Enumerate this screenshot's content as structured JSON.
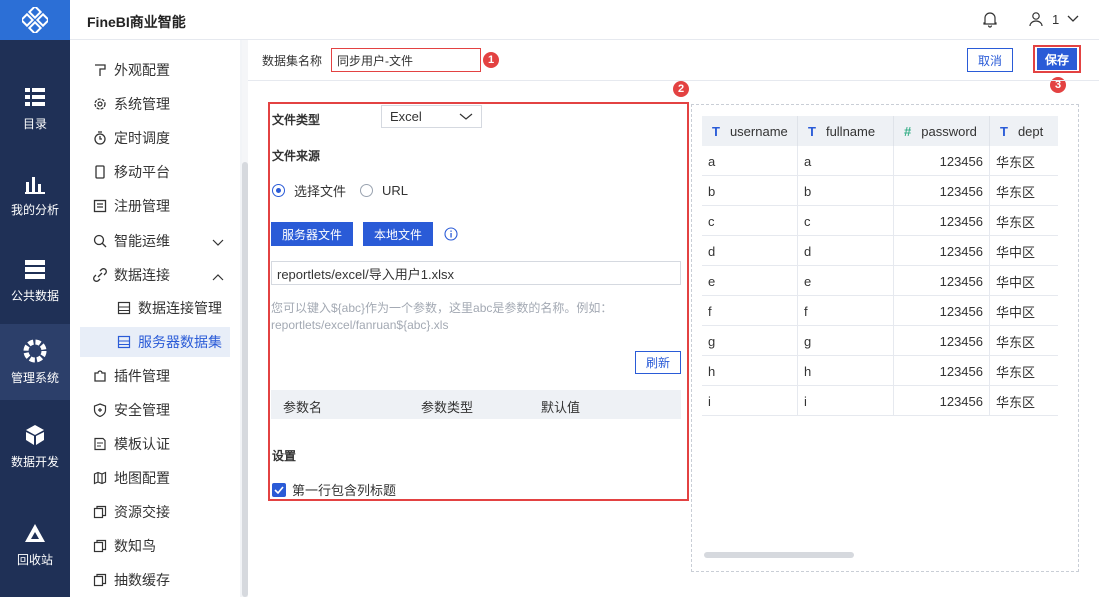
{
  "app": {
    "title": "FineBI商业智能"
  },
  "user": {
    "name": "1"
  },
  "leftnav": [
    {
      "label": "目录",
      "icon": "catalog-icon"
    },
    {
      "label": "我的分析",
      "icon": "analysis-icon"
    },
    {
      "label": "公共数据",
      "icon": "database-icon"
    },
    {
      "label": "管理系统",
      "icon": "gear-icon"
    },
    {
      "label": "数据开发",
      "icon": "cube-icon"
    },
    {
      "label": "回收站",
      "icon": "recycle-icon"
    }
  ],
  "sidemenu": [
    {
      "label": "外观配置"
    },
    {
      "label": "系统管理"
    },
    {
      "label": "定时调度"
    },
    {
      "label": "移动平台"
    },
    {
      "label": "注册管理"
    },
    {
      "label": "智能运维"
    },
    {
      "label": "数据连接"
    },
    {
      "label": "数据连接管理"
    },
    {
      "label": "服务器数据集"
    },
    {
      "label": "插件管理"
    },
    {
      "label": "安全管理"
    },
    {
      "label": "模板认证"
    },
    {
      "label": "地图配置"
    },
    {
      "label": "资源交接"
    },
    {
      "label": "数知鸟"
    },
    {
      "label": "抽数缓存"
    }
  ],
  "form": {
    "dataset_label": "数据集名称",
    "dataset_name": "同步用户-文件",
    "cancel": "取消",
    "save": "保存",
    "badges": [
      "1",
      "2",
      "3"
    ],
    "file_type_label": "文件类型",
    "file_type_value": "Excel",
    "file_source_label": "文件来源",
    "radio_select_file": "选择文件",
    "radio_url": "URL",
    "server_file_btn": "服务器文件",
    "local_file_btn": "本地文件",
    "file_path": "reportlets/excel/导入用户1.xlsx",
    "hint_line1": "您可以键入${abc}作为一个参数，这里abc是参数的名称。例如：",
    "hint_line2": "reportlets/excel/fanruan${abc}.xls",
    "refresh": "刷新",
    "param_cols": [
      "参数名",
      "参数类型",
      "默认值"
    ],
    "settings_label": "设置",
    "first_row_header": "第一行包含列标题"
  },
  "preview": {
    "columns": [
      {
        "name": "username",
        "type": "T"
      },
      {
        "name": "fullname",
        "type": "T"
      },
      {
        "name": "password",
        "type": "#"
      },
      {
        "name": "dept",
        "type": "T"
      }
    ],
    "rows": [
      [
        "a",
        "a",
        "123456",
        "华东区"
      ],
      [
        "b",
        "b",
        "123456",
        "华东区"
      ],
      [
        "c",
        "c",
        "123456",
        "华东区"
      ],
      [
        "d",
        "d",
        "123456",
        "华中区"
      ],
      [
        "e",
        "e",
        "123456",
        "华中区"
      ],
      [
        "f",
        "f",
        "123456",
        "华中区"
      ],
      [
        "g",
        "g",
        "123456",
        "华东区"
      ],
      [
        "h",
        "h",
        "123456",
        "华东区"
      ],
      [
        "i",
        "i",
        "123456",
        "华东区"
      ]
    ]
  }
}
